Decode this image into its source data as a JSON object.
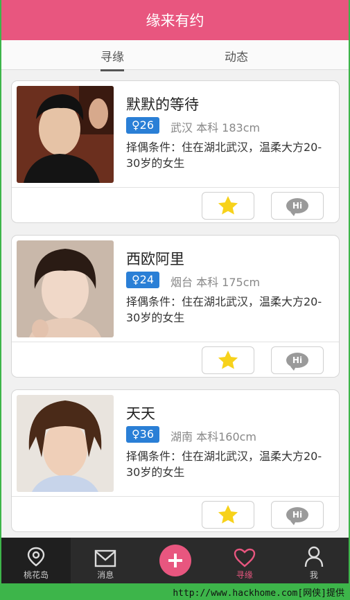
{
  "header": {
    "title": "缘来有约"
  },
  "tabs": [
    {
      "label": "寻缘",
      "active": true
    },
    {
      "label": "动态",
      "active": false
    }
  ],
  "cards": [
    {
      "name": "默默的等待",
      "badge": "♀26",
      "meta": "武汉 本科 183cm",
      "condition": "择偶条件：住在湖北武汉，温柔大方20-30岁的女生"
    },
    {
      "name": "西欧阿里",
      "badge": "♀24",
      "meta": "烟台 本科 175cm",
      "condition": "择偶条件：住在湖北武汉，温柔大方20-30岁的女生"
    },
    {
      "name": "天天",
      "badge": "♀36",
      "meta": "湖南 本科160cm",
      "condition": "择偶条件：住在湖北武汉，温柔大方20-30岁的女生"
    }
  ],
  "actions": {
    "hi_label": "Hi"
  },
  "nav": [
    {
      "label": "桃花岛",
      "icon": "location-pin-icon"
    },
    {
      "label": "消息",
      "icon": "mail-icon"
    },
    {
      "label": "",
      "icon": "plus-icon"
    },
    {
      "label": "寻缘",
      "icon": "heart-icon",
      "active": true
    },
    {
      "label": "我",
      "icon": "user-icon"
    }
  ],
  "colors": {
    "accent": "#e8567f",
    "badge": "#2a7fd6",
    "star": "#f7d21b",
    "nav_bg": "#2b2b2b",
    "frame": "#3db54a"
  },
  "watermark": "http://www.hackhome.com[网侠]提供"
}
